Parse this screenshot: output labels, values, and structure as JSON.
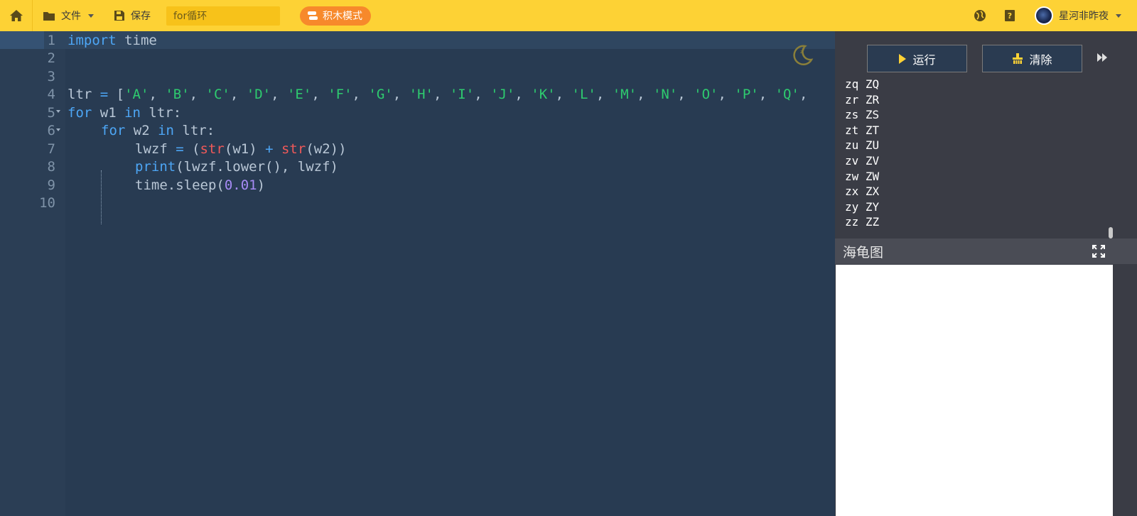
{
  "toolbar": {
    "file_label": "文件",
    "save_label": "保存",
    "project_title": "for循环",
    "mode_label": "积木模式",
    "username": "星河非昨夜",
    "icons": [
      "home-icon",
      "folder-icon",
      "save-icon",
      "blocks-icon",
      "globe-icon",
      "help-book-icon",
      "avatar"
    ]
  },
  "editor": {
    "line_numbers": [
      "1",
      "2",
      "3",
      "4",
      "5",
      "6",
      "7",
      "8",
      "9",
      "10"
    ],
    "code": {
      "l1": {
        "kw": "import",
        "rest": " time"
      },
      "l4": {
        "name": "ltr",
        "eq": " = ",
        "open": "[",
        "items": [
          "'A'",
          "'B'",
          "'C'",
          "'D'",
          "'E'",
          "'F'",
          "'G'",
          "'H'",
          "'I'",
          "'J'",
          "'K'",
          "'L'",
          "'M'",
          "'N'",
          "'O'",
          "'P'",
          "'Q'"
        ],
        "sep": ", "
      },
      "l5": {
        "kw1": "for",
        "var": " w1 ",
        "kw2": "in",
        "rest": " ltr:"
      },
      "l6": {
        "kw1": "for",
        "var": " w2 ",
        "kw2": "in",
        "rest": " ltr:"
      },
      "l7": {
        "a": "lwzf ",
        "eq": "=",
        "b": " (",
        "f1": "str",
        "c": "(w1) ",
        "plus": "+",
        "d": " ",
        "f2": "str",
        "e": "(w2))"
      },
      "l8": {
        "f": "print",
        "rest": "(lwzf.lower(), lwzf)"
      },
      "l9": {
        "a": "time.sleep(",
        "n": "0.01",
        "b": ")"
      }
    }
  },
  "panel": {
    "run_label": "运行",
    "clear_label": "清除",
    "output_lines": [
      "zq ZQ",
      "zr ZR",
      "zs ZS",
      "zt ZT",
      "zu ZU",
      "zv ZV",
      "zw ZW",
      "zx ZX",
      "zy ZY",
      "zz ZZ"
    ],
    "turtle_title": "海龟图"
  },
  "colors": {
    "toolbar_bg": "#fdd235",
    "editor_bg": "#283b52",
    "keyword": "#4da6f5",
    "string": "#2ecb6f",
    "builtin": "#f05959",
    "number": "#a78bf5",
    "mode_button": "#f7892b"
  }
}
